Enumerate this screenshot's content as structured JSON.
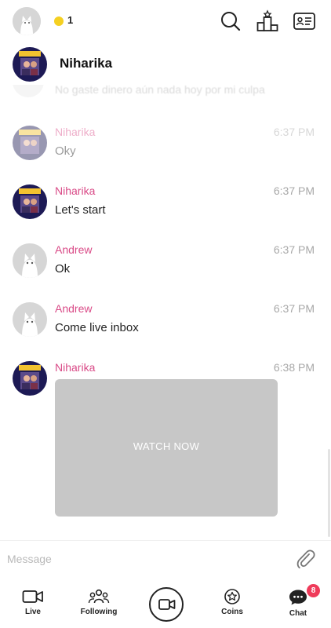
{
  "topbar": {
    "coin_count": "1",
    "icons": [
      "search-icon",
      "leaderboard-icon",
      "id-card-icon"
    ],
    "coin_color": "#f5d021"
  },
  "header": {
    "name": "Niharika"
  },
  "faded_message": "No gaste dinero aún nada hoy por mi culpa",
  "messages": [
    {
      "sender": "Niharika",
      "time": "6:37 PM",
      "text": "Oky",
      "avatar": "niharika"
    },
    {
      "sender": "Niharika",
      "time": "6:37 PM",
      "text": "Let's start",
      "avatar": "niharika"
    },
    {
      "sender": "Andrew",
      "time": "6:37 PM",
      "text": "Ok",
      "avatar": "andrew"
    },
    {
      "sender": "Andrew",
      "time": "6:37 PM",
      "text": "Come live inbox",
      "avatar": "andrew"
    },
    {
      "sender": "Niharika",
      "time": "6:38 PM",
      "text": "",
      "avatar": "niharika"
    }
  ],
  "video_card": {
    "label": "WATCH NOW"
  },
  "input": {
    "placeholder": "Message"
  },
  "nav": {
    "live": "Live",
    "following": "Following",
    "coins": "Coins",
    "chat": "Chat",
    "chat_badge": "8"
  },
  "colors": {
    "sender": "#d94a87",
    "badge": "#ef3b5a",
    "card": "#c7c7c7"
  }
}
